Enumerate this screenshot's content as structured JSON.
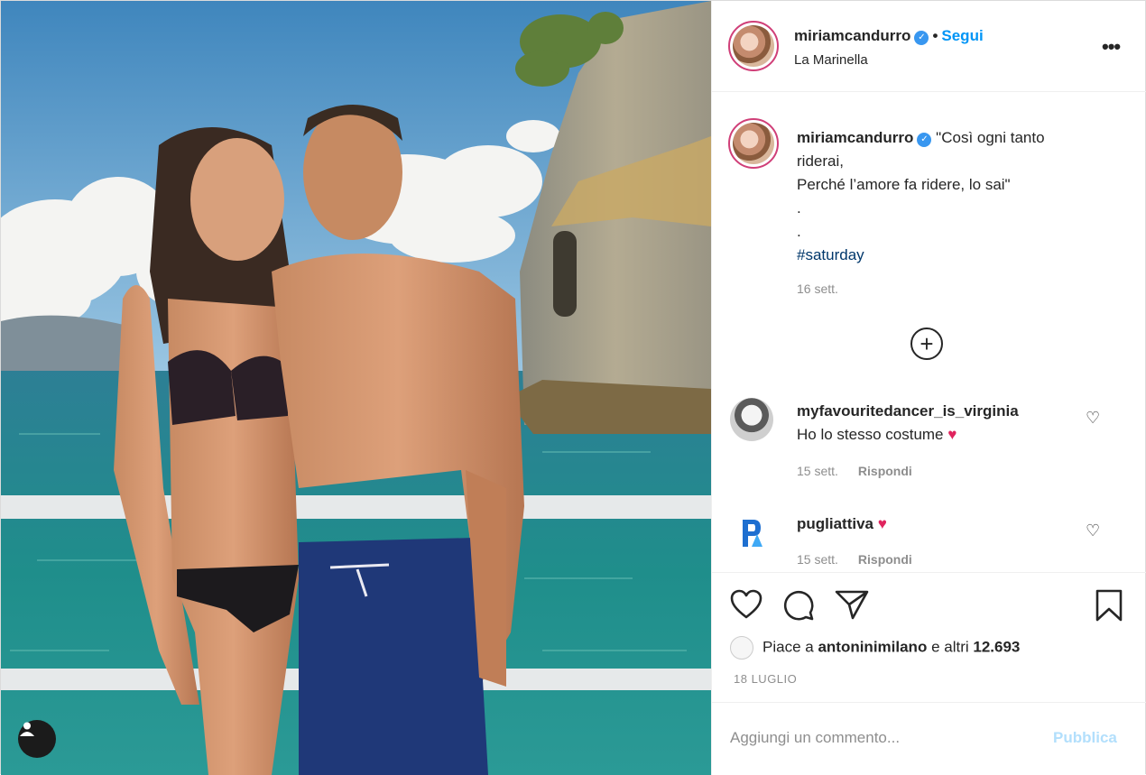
{
  "post": {
    "username": "miriamcandurro",
    "verified": true,
    "follow_label": "Segui",
    "location": "La Marinella",
    "more_icon": "more-options-icon",
    "caption": {
      "lines": [
        "\"Così ogni tanto",
        "riderai,",
        "Perché l’amore fa ridere, lo sai\"",
        ".",
        "."
      ],
      "hashtag": "#saturday",
      "time": "16 sett."
    },
    "load_more_icon": "plus-circle-icon",
    "comments": [
      {
        "username": "myfavouritedancer_is_virginia",
        "text": "Ho lo stesso costume",
        "has_heart": true,
        "time": "15 sett.",
        "reply_label": "Rispondi",
        "avatar_icon": "user-avatar"
      },
      {
        "username": "pugliattiva",
        "text": "",
        "has_heart": true,
        "time": "15 sett.",
        "reply_label": "Rispondi",
        "avatar_icon": "pugliattiva-logo"
      }
    ],
    "likes_prefix": "Piace a",
    "likes_user": "antoninimilano",
    "likes_suffix": "e altri",
    "likes_count": "12.693",
    "date": "18 LUGLIO",
    "add_comment_placeholder": "Aggiungi un commento...",
    "publish_label": "Pubblica",
    "colors": {
      "link_blue": "#0095f6",
      "verified_blue": "#3897f0",
      "heart_red": "#e0245e",
      "muted_gray": "#8e8e8e",
      "publish_disabled": "#b2dffc"
    }
  }
}
